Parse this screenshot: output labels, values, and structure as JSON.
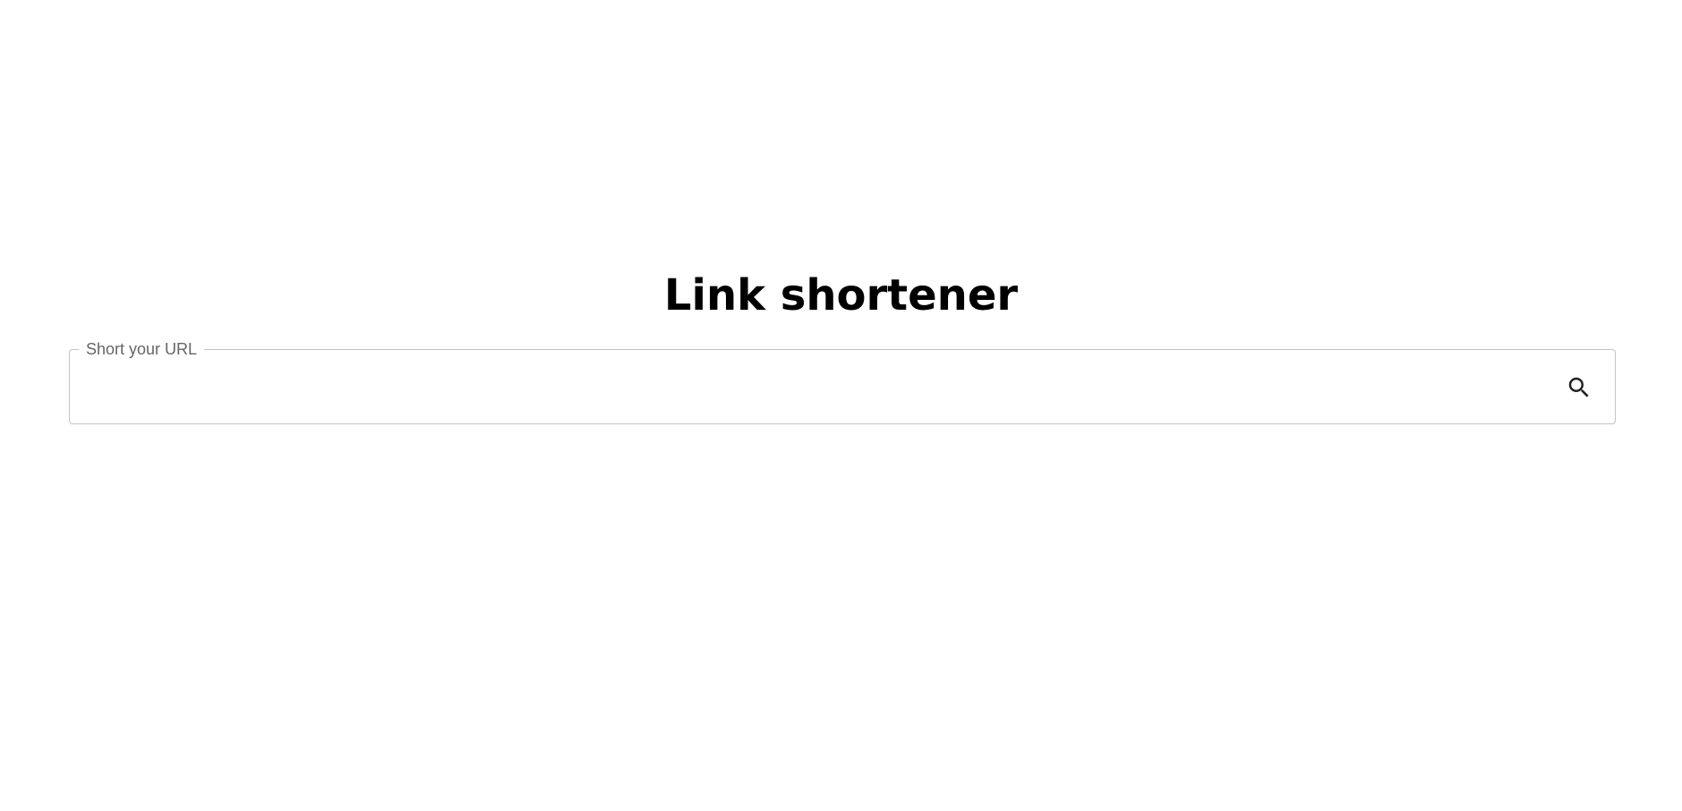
{
  "page": {
    "title": "Link shortener"
  },
  "url_form": {
    "label": "Short your URL",
    "value": "",
    "search_icon": "search-icon"
  },
  "colors": {
    "background": "#ffffff",
    "title": "#000000",
    "border": "#c4c4c4",
    "label": "#666666",
    "icon": "#222222"
  }
}
